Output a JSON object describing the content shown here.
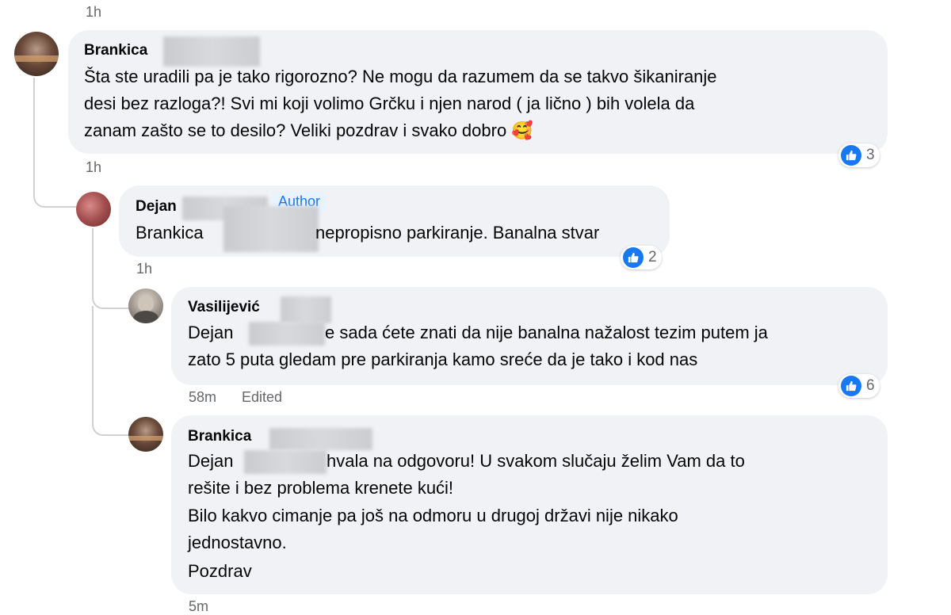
{
  "comments": [
    {
      "author": "Brankica",
      "lines": [
        "Šta ste uradili pa je tako rigorozno? Ne mogu da razumem da se takvo šikaniranje",
        "desi bez razloga?! Svi mi koji volimo Grčku i njen narod ( ja lično ) bih volela da",
        "zanam zašto se to desilo? Veliki pozdrav i svako dobro 🥰"
      ],
      "time": "1h",
      "reactions": "3"
    },
    {
      "author": "Dejan",
      "badge": "Author",
      "text_prefix": "Brankica",
      "text_suffix": "nepropisno parkiranje. Banalna stvar",
      "time": "1h",
      "reactions": "2"
    },
    {
      "author": "Vasilijević",
      "line1_prefix": "Dejan",
      "line1_suffix": "e sada ćete znati da nije banalna nažalost tezim putem ja",
      "line2": "zato 5 puta gledam pre parkiranja kamo sreće da je tako i kod nas",
      "time": "58m",
      "edited": "Edited",
      "reactions": "6"
    },
    {
      "author": "Brankica",
      "line1_prefix": "Dejan",
      "line1_suffix": "hvala na odgovoru! U svakom slučaju želim Vam da to",
      "lines_rest": [
        "rešite i bez problema krenete kući!",
        "Bilo kakvo cimanje pa još na odmoru u drugoj državi nije nikako",
        "jednostavno.",
        "Pozdrav"
      ],
      "time": "5m"
    }
  ],
  "top_time": "1h",
  "icons": {
    "like": "thumbs-up-icon"
  },
  "colors": {
    "bubble": "#f0f2f5",
    "like": "#1877f2",
    "meta": "#65676b"
  }
}
